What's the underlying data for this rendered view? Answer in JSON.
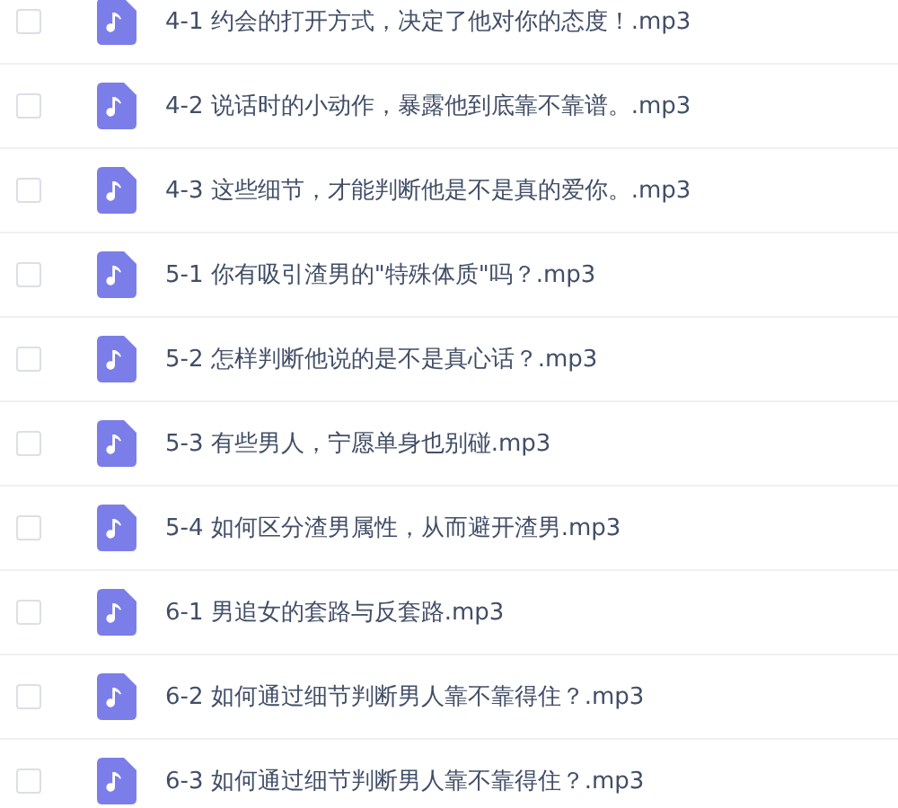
{
  "files": [
    {
      "name": "4-1 约会的打开方式，决定了他对你的态度！.mp3",
      "checked": false
    },
    {
      "name": "4-2 说话时的小动作，暴露他到底靠不靠谱。.mp3",
      "checked": false
    },
    {
      "name": "4-3 这些细节，才能判断他是不是真的爱你。.mp3",
      "checked": false
    },
    {
      "name": "5-1 你有吸引渣男的\"特殊体质\"吗？.mp3",
      "checked": false
    },
    {
      "name": "5-2 怎样判断他说的是不是真心话？.mp3",
      "checked": false
    },
    {
      "name": "5-3 有些男人，宁愿单身也别碰.mp3",
      "checked": false
    },
    {
      "name": "5-4 如何区分渣男属性，从而避开渣男.mp3",
      "checked": false
    },
    {
      "name": "6-1 男追女的套路与反套路.mp3",
      "checked": false
    },
    {
      "name": "6-2 如何通过细节判断男人靠不靠得住？.mp3",
      "checked": false
    },
    {
      "name": "6-3 如何通过细节判断男人靠不靠得住？.mp3",
      "checked": false
    }
  ]
}
